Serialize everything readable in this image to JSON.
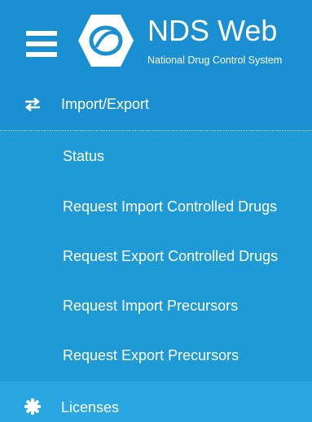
{
  "header": {
    "title": "NDS Web",
    "subtitle": "National Drug Control System"
  },
  "sections": {
    "import_export": {
      "label": "Import/Export",
      "icon": "arrows-exchange-icon"
    },
    "licenses": {
      "label": "Licenses",
      "icon": "gear-icon"
    }
  },
  "submenu": [
    {
      "label": "Status"
    },
    {
      "label": "Request Import Controlled Drugs"
    },
    {
      "label": "Request Export Controlled Drugs"
    },
    {
      "label": "Request Import Precursors"
    },
    {
      "label": "Request Export Precursors"
    }
  ],
  "colors": {
    "sidebar_bg": "#1e9ad6",
    "header_bg": "#1a8fd2",
    "text": "#ffffff"
  }
}
